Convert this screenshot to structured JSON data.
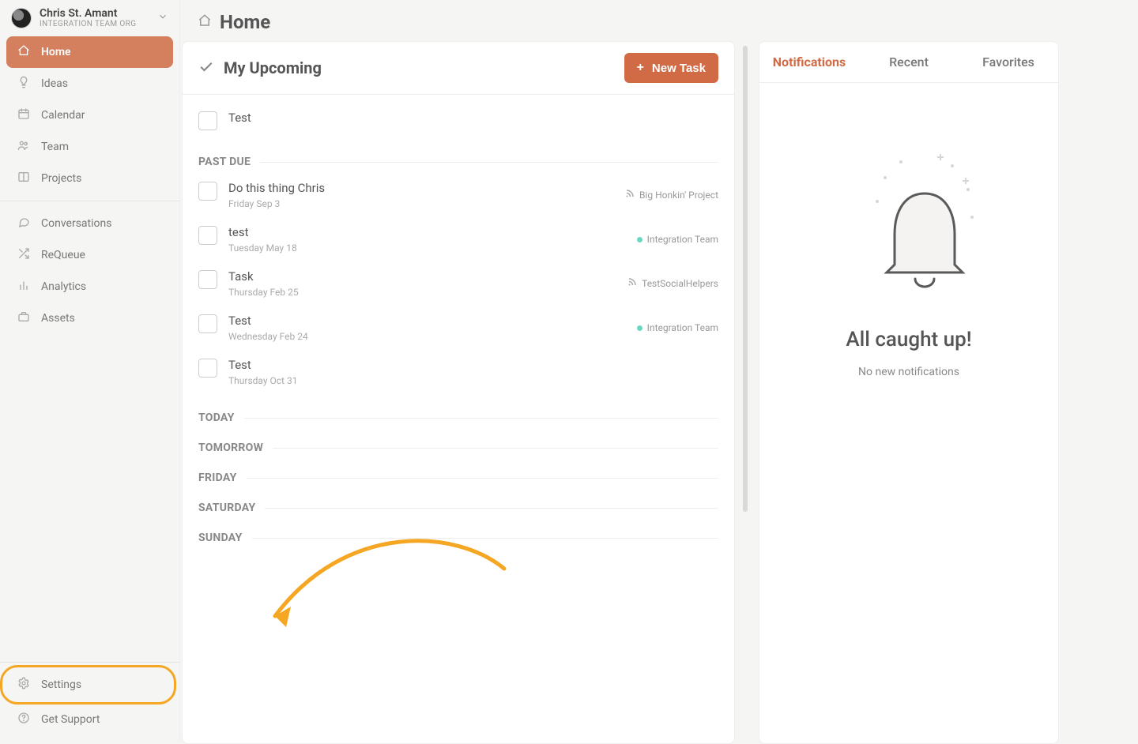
{
  "user": {
    "name": "Chris St. Amant",
    "org": "INTEGRATION TEAM ORG"
  },
  "page": {
    "title": "Home"
  },
  "sidebar": {
    "main": [
      {
        "label": "Home",
        "icon": "home",
        "active": true
      },
      {
        "label": "Ideas",
        "icon": "bulb"
      },
      {
        "label": "Calendar",
        "icon": "calendar"
      },
      {
        "label": "Team",
        "icon": "team"
      },
      {
        "label": "Projects",
        "icon": "projects"
      }
    ],
    "secondary": [
      {
        "label": "Conversations",
        "icon": "chat"
      },
      {
        "label": "ReQueue",
        "icon": "shuffle"
      },
      {
        "label": "Analytics",
        "icon": "bars"
      },
      {
        "label": "Assets",
        "icon": "case"
      }
    ],
    "bottom": [
      {
        "label": "Settings",
        "icon": "gear",
        "highlight": true
      },
      {
        "label": "Get Support",
        "icon": "help"
      }
    ]
  },
  "upcoming": {
    "title": "My Upcoming",
    "new_task_label": "New Task",
    "first_task": {
      "title": "Test"
    },
    "sections": [
      {
        "label": "PAST DUE",
        "tasks": [
          {
            "title": "Do this thing Chris",
            "date": "Friday Sep 3",
            "meta_label": "Big Honkin' Project",
            "meta_kind": "rss"
          },
          {
            "title": "test",
            "date": "Tuesday May 18",
            "meta_label": "Integration Team",
            "meta_kind": "dot"
          },
          {
            "title": "Task",
            "date": "Thursday Feb 25",
            "meta_label": "TestSocialHelpers",
            "meta_kind": "rss"
          },
          {
            "title": "Test",
            "date": "Wednesday Feb 24",
            "meta_label": "Integration Team",
            "meta_kind": "dot"
          },
          {
            "title": "Test",
            "date": "Thursday Oct 31"
          }
        ]
      },
      {
        "label": "TODAY",
        "tasks": []
      },
      {
        "label": "TOMORROW",
        "tasks": []
      },
      {
        "label": "FRIDAY",
        "tasks": []
      },
      {
        "label": "SATURDAY",
        "tasks": []
      },
      {
        "label": "SUNDAY",
        "tasks": []
      }
    ]
  },
  "right": {
    "tabs": [
      {
        "label": "Notifications",
        "active": true
      },
      {
        "label": "Recent"
      },
      {
        "label": "Favorites"
      }
    ],
    "empty_title": "All caught up!",
    "empty_sub": "No new notifications"
  }
}
